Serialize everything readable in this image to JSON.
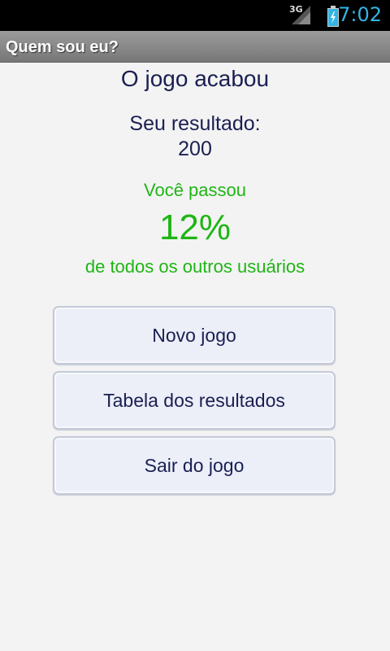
{
  "status_bar": {
    "network": "3G",
    "time": "7:02"
  },
  "app": {
    "title": "Quem sou eu?"
  },
  "result": {
    "heading": "O jogo acabou",
    "score_label": "Seu resultado:",
    "score_value": "200",
    "passed_label": "Você passou",
    "percent": "12%",
    "users_label": "de todos os outros usuários"
  },
  "buttons": {
    "new_game": "Novo jogo",
    "results_table": "Tabela dos resultados",
    "exit_game": "Sair do jogo"
  },
  "colors": {
    "status_clock": "#33b5e5",
    "text_dark": "#1a1f52",
    "text_green": "#1fb515",
    "button_bg": "#eceef8",
    "title_bar": "#888888"
  },
  "icons": {
    "network": "signal-3g-icon",
    "battery": "battery-charging-icon"
  }
}
